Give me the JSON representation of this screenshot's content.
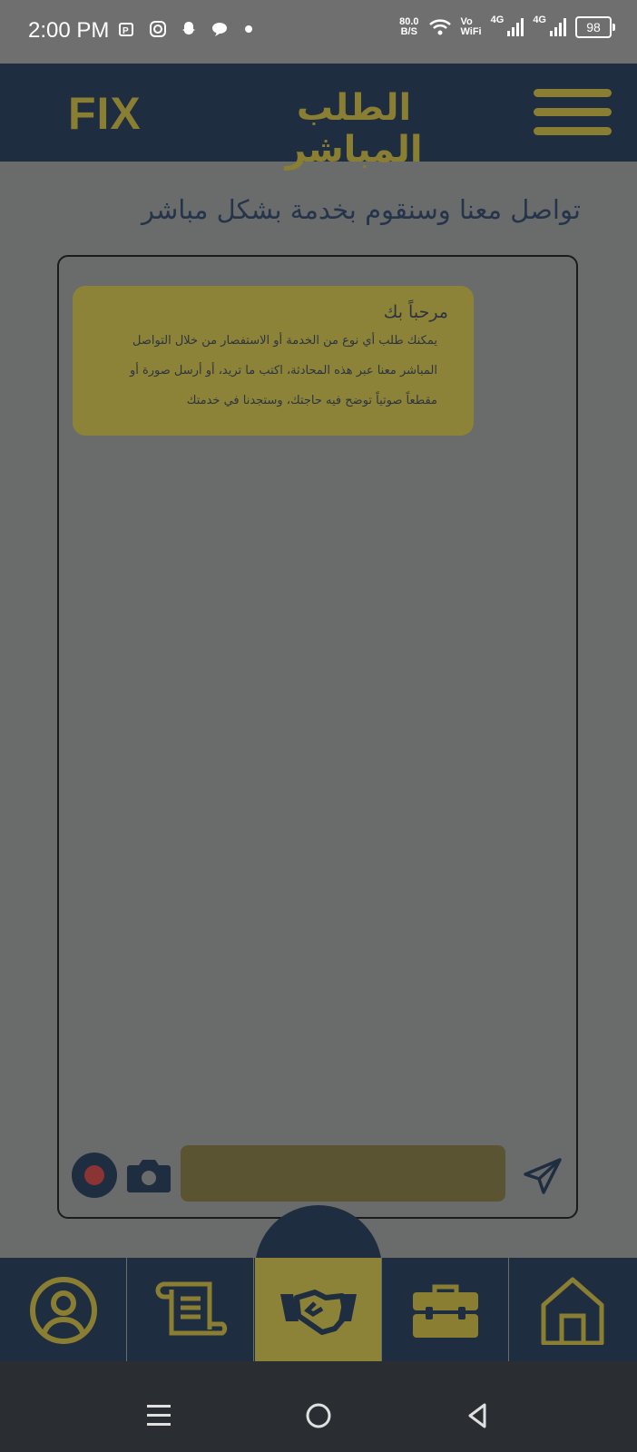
{
  "status_bar": {
    "time": "2:00 PM",
    "speed_value": "80.0",
    "speed_unit": "B/S",
    "vo_label": "Vo",
    "wifi_label": "WiFi",
    "signal1_label": "4G",
    "signal2_label": "4G",
    "battery": "98"
  },
  "header": {
    "logo": "FIX",
    "title": "الطلب المباشر"
  },
  "subtitle": "تواصل معنا وسنقوم بخدمة بشكل مباشر",
  "chat": {
    "messages": [
      {
        "title": "مرحباً بك",
        "lines": [
          "يمكنك طلب أي نوع من الخدمة أو الاستفصار من خلال التواصل",
          "المباشر معنا عبر هذه المحادثة، اكتب ما تريد، أو أرسل صورة أو",
          "مقطعاً صوتياً توضح فيه حاجتك، وستجدنا في خدمتك"
        ]
      }
    ],
    "input_value": "",
    "input_placeholder": ""
  },
  "bottom_nav": {
    "items": [
      {
        "icon": "user-circle-icon",
        "active": false
      },
      {
        "icon": "scroll-document-icon",
        "active": false
      },
      {
        "icon": "handshake-icon",
        "active": true
      },
      {
        "icon": "toolbox-icon",
        "active": false
      },
      {
        "icon": "home-icon",
        "active": false
      }
    ]
  },
  "colors": {
    "primary_dark": "#1f2d40",
    "accent_gold": "#8a7e32",
    "overlay_grey": "#6a6c6c"
  }
}
